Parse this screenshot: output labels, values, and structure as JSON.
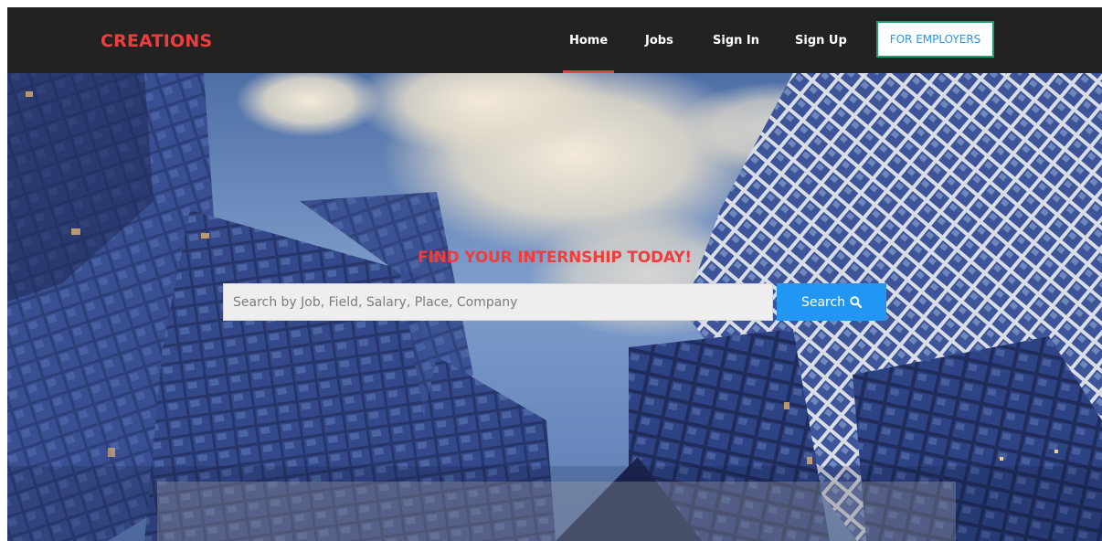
{
  "navbar": {
    "brand": "CREATIONS",
    "items": [
      {
        "label": "Home",
        "active": true
      },
      {
        "label": "Jobs",
        "active": false
      },
      {
        "label": "Sign In",
        "active": false
      },
      {
        "label": "Sign Up",
        "active": false
      }
    ],
    "employers_button": "FOR EMPLOYERS"
  },
  "hero": {
    "headline": "FIND YOUR INTERNSHIP TODAY!",
    "search": {
      "placeholder": "Search by Job, Field, Salary, Place, Company",
      "value": "",
      "button_label": "Search",
      "button_icon": "search-icon"
    }
  },
  "colors": {
    "navbar_bg": "#222222",
    "brand": "#ef3d3d",
    "accent_blue": "#2196f3",
    "employers_border": "#1e9d6a"
  }
}
